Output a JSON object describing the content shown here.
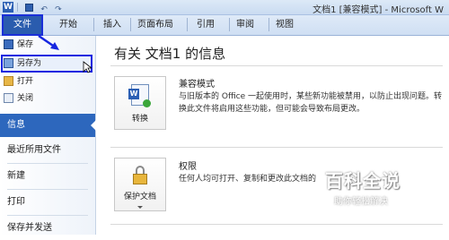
{
  "titlebar": {
    "app_icon_letter": "W",
    "window_title": "文档1 [兼容模式] - Microsoft W"
  },
  "tabs": {
    "file": "文件",
    "items": [
      "开始",
      "插入",
      "页面布局",
      "引用",
      "审阅",
      "视图"
    ]
  },
  "nav": {
    "save": "保存",
    "save_as": "另存为",
    "open": "打开",
    "close": "关闭",
    "info": "信息",
    "recent": "最近所用文件",
    "new": "新建",
    "print": "打印",
    "save_send": "保存并发送"
  },
  "main": {
    "title": "有关 文档1 的信息",
    "compat": {
      "button_label": "转换",
      "heading": "兼容模式",
      "line1": "与旧版本的 Office 一起使用时，某些新功能被禁用，以防止出现问题。转",
      "line2": "换此文件将启用这些功能，但可能会导致布局更改。"
    },
    "permissions": {
      "button_label": "保护文档",
      "heading": "权限",
      "line1": "任何人均可打开、复制和更改此文档的"
    }
  },
  "watermark": {
    "main": "百科全说",
    "sub": "助你轻松解决"
  },
  "colors": {
    "accent": "#2d67bd",
    "annotation": "#1626e0"
  }
}
